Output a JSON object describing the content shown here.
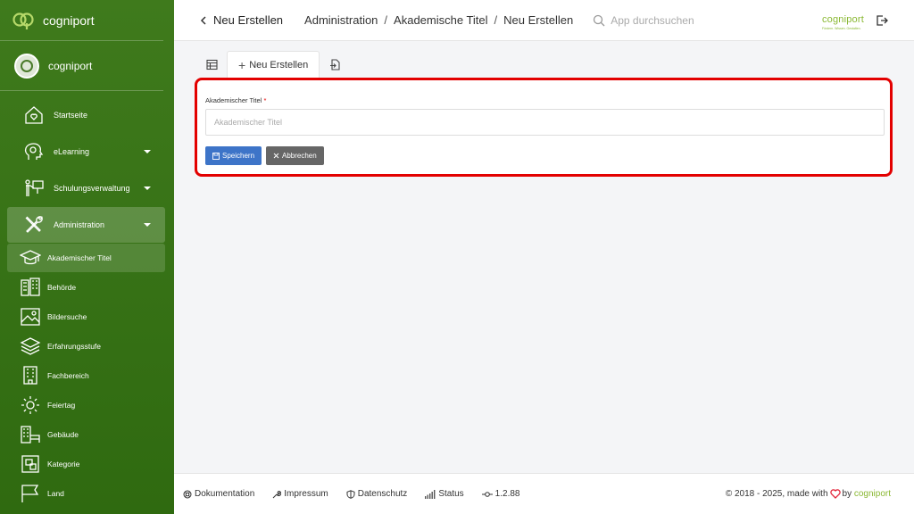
{
  "app": {
    "name": "cogniport"
  },
  "user": {
    "name": "cogniport"
  },
  "sidebar": {
    "items": [
      {
        "label": "Startseite",
        "icon": "home-heart-icon",
        "expandable": false
      },
      {
        "label": "eLearning",
        "icon": "head-gear-icon",
        "expandable": true
      },
      {
        "label": "Schulungsverwaltung",
        "icon": "presenter-board-icon",
        "expandable": true
      },
      {
        "label": "Administration",
        "icon": "tools-icon",
        "expandable": true,
        "active": true
      }
    ],
    "subitems": [
      {
        "label": "Akademischer Titel",
        "icon": "graduation-cap-icon",
        "active": true
      },
      {
        "label": "Behörde",
        "icon": "buildings-icon"
      },
      {
        "label": "Bildersuche",
        "icon": "image-icon"
      },
      {
        "label": "Erfahrungsstufe",
        "icon": "layers-icon"
      },
      {
        "label": "Fachbereich",
        "icon": "building-icon"
      },
      {
        "label": "Feiertag",
        "icon": "sun-icon"
      },
      {
        "label": "Gebäude",
        "icon": "building-bed-icon"
      },
      {
        "label": "Kategorie",
        "icon": "category-icon"
      },
      {
        "label": "Land",
        "icon": "flag-icon"
      }
    ]
  },
  "header": {
    "back_title": "Neu Erstellen",
    "breadcrumb": [
      "Administration",
      "Akademische Titel",
      "Neu Erstellen"
    ],
    "search_placeholder": "App durchsuchen",
    "logo_text": "cogniport",
    "logo_tagline": "Fördern. Wissen. Gestalten."
  },
  "tabs": {
    "active_label": "Neu Erstellen"
  },
  "form": {
    "field_label": "Akademischer Titel",
    "required_mark": "*",
    "field_placeholder": "Akademischer Titel",
    "field_value": "",
    "save_label": "Speichern",
    "cancel_label": "Abbrechen"
  },
  "footer": {
    "links": [
      "Dokumentation",
      "Impressum",
      "Datenschutz",
      "Status"
    ],
    "version": "1.2.88",
    "copyright": "© 2018 - 2025, made with",
    "by": "by",
    "brand": "cogniport"
  },
  "colors": {
    "sidebar_green": "#3f7a1c",
    "accent_lime": "#8ab833",
    "primary_blue": "#3d74c8",
    "highlight_red": "#e30000"
  }
}
